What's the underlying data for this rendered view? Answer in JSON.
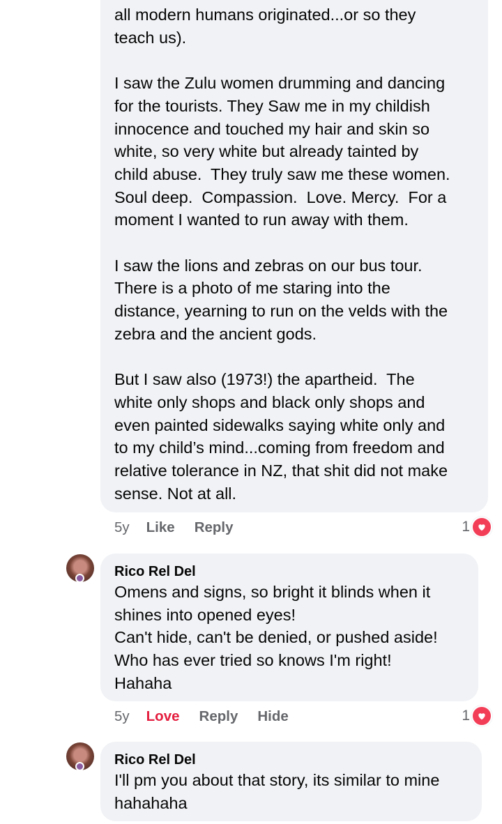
{
  "comments": [
    {
      "body": "all modern humans originated...or so they\nteach us).\n\nI saw the Zulu women drumming and dancing\nfor the tourists. They Saw me in my childish\ninnocence and touched my hair and skin so\nwhite, so very white but already tainted by\nchild abuse.  They truly saw me these women.\nSoul deep.  Compassion.  Love. Mercy.  For a\nmoment I wanted to run away with them.\n\nI saw the lions and zebras on our bus tour.\nThere is a photo of me staring into the\ndistance, yearning to run on the velds with the\nzebra and the ancient gods.\n\nBut I saw also (1973!) the apartheid.  The\nwhite only shops and black only shops and\neven painted sidewalks saying white only and\nto my child’s mind...coming from freedom and\nrelative tolerance in NZ, that shit did not make\nsense. Not at all.",
      "time": "5y",
      "like_label": "Like",
      "reply_label": "Reply",
      "reaction_count": "1"
    },
    {
      "author": "Rico Rel Del",
      "body": "Omens and signs, so bright it blinds when it\nshines into opened eyes!\nCan't hide, can't be denied, or pushed aside!\nWho has ever tried so knows I'm right!\nHahaha",
      "time": "5y",
      "love_label": "Love",
      "reply_label": "Reply",
      "hide_label": "Hide",
      "reaction_count": "1"
    },
    {
      "author": "Rico Rel Del",
      "body": "I'll pm you about that story, its similar to mine\nhahahaha"
    }
  ],
  "colors": {
    "bubble": "#f0f2f5",
    "love": "#e41e3f",
    "heart": "#f33e58",
    "meta": "#65676b"
  }
}
